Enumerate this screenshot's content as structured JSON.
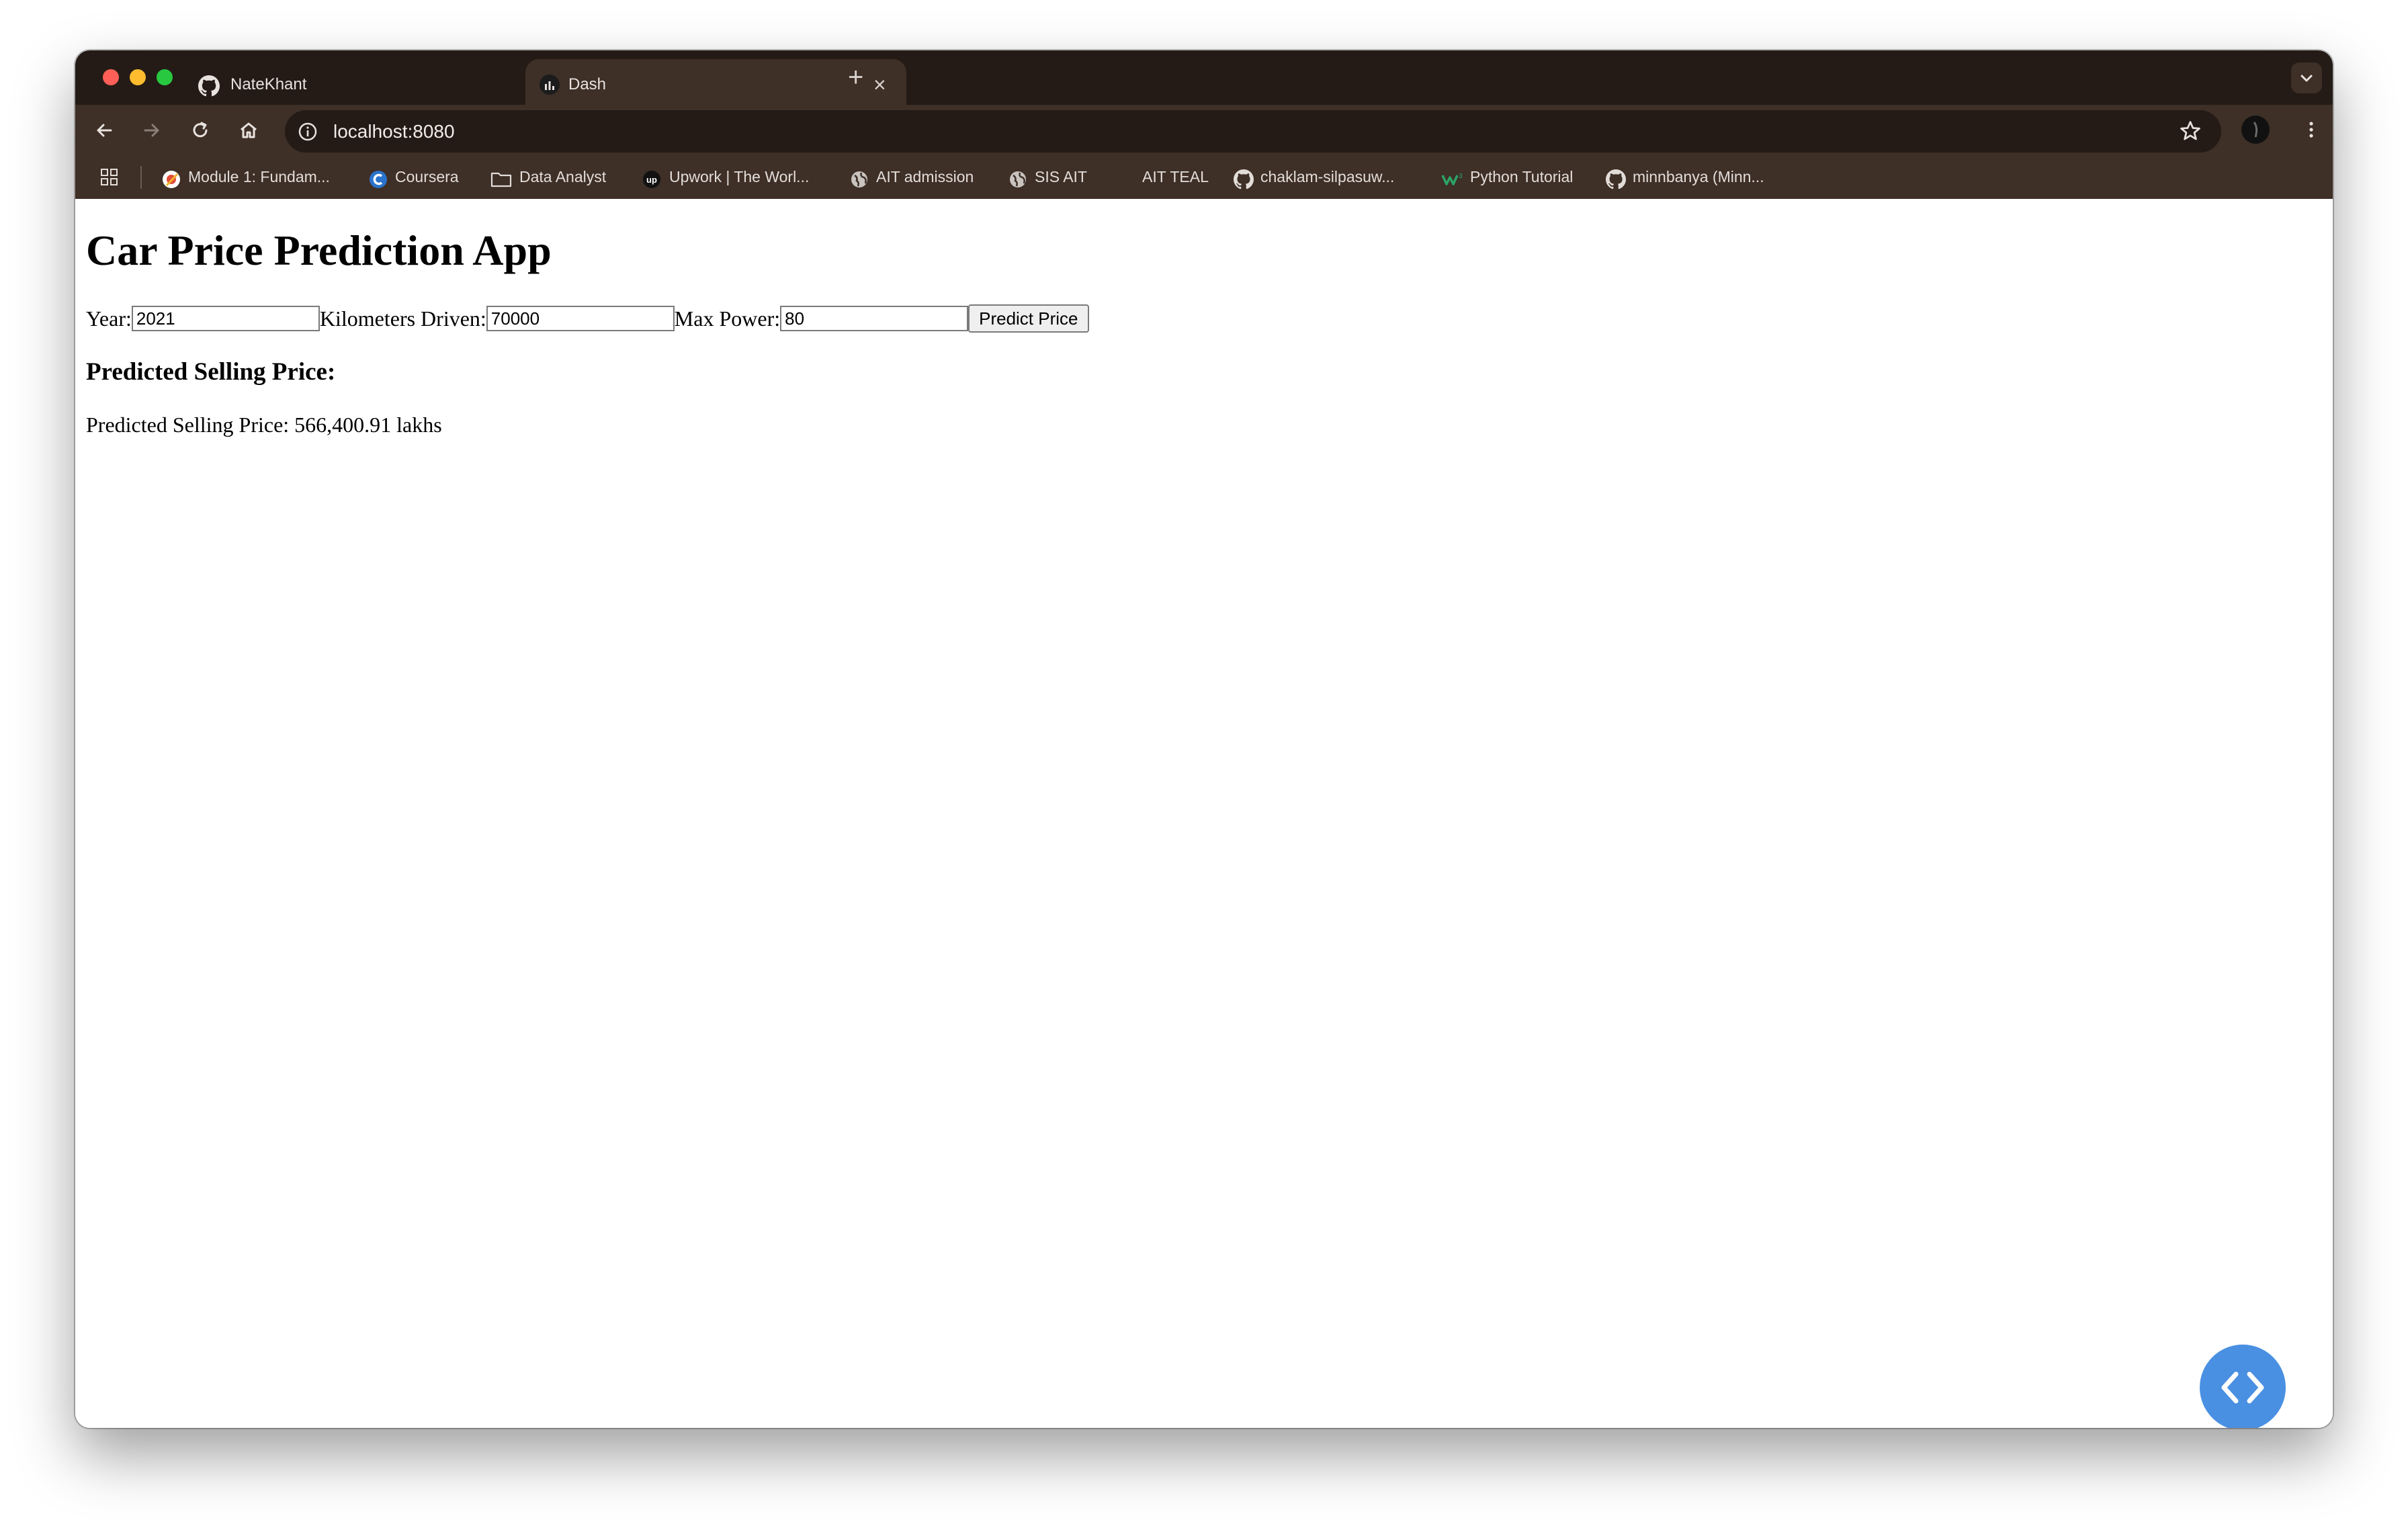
{
  "browser": {
    "tabs": [
      {
        "title": "NateKhant",
        "icon": "github-icon",
        "active": false
      },
      {
        "title": "Dash",
        "icon": "dash-icon",
        "active": true
      }
    ],
    "url": "localhost:8080",
    "bookmarks": [
      {
        "label": "Module 1: Fundam...",
        "icon": "module-icon"
      },
      {
        "label": "Coursera",
        "icon": "coursera-icon"
      },
      {
        "label": "Data Analyst",
        "icon": "folder-icon"
      },
      {
        "label": "Upwork | The Worl...",
        "icon": "upwork-icon"
      },
      {
        "label": "AIT admission",
        "icon": "globe-icon"
      },
      {
        "label": "SIS AIT",
        "icon": "globe-icon"
      },
      {
        "label": "AIT TEAL",
        "icon": ""
      },
      {
        "label": "chaklam-silpasuw...",
        "icon": "github-icon"
      },
      {
        "label": "Python Tutorial",
        "icon": "w3schools-icon"
      },
      {
        "label": "minnbanya (Minn...",
        "icon": "github-icon"
      }
    ],
    "colors": {
      "tabstrip": "#241b16",
      "toolbar": "#3e2f27",
      "fab": "#4a90e2"
    }
  },
  "app": {
    "title": "Car Price Prediction App",
    "form": {
      "year_label": "Year:",
      "year_value": "2021",
      "km_label": "Kilometers Driven:",
      "km_value": "70000",
      "power_label": "Max Power:",
      "power_value": "80",
      "button_label": "Predict Price"
    },
    "result_heading": "Predicted Selling Price:",
    "result_text": "Predicted Selling Price: 566,400.91 lakhs"
  }
}
